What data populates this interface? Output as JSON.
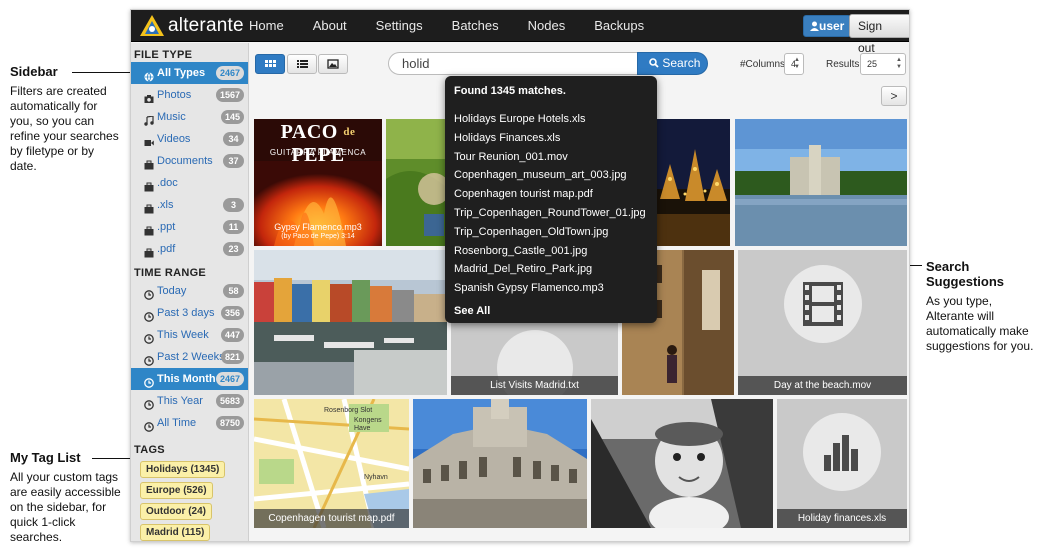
{
  "annotations": {
    "sidebar": {
      "title": "Sidebar",
      "text": "Filters are created automatically for you, so you can refine your searches by filetype or by date."
    },
    "tags": {
      "title": "My Tag List",
      "text": "All your custom tags are easily accessible on the sidebar, for quick 1-click searches."
    },
    "suggestions": {
      "title": "Search Suggestions",
      "text": "As you type, Alterante will automatically make suggestions for you."
    }
  },
  "app": {
    "logo_text": "alterante",
    "nav": [
      "Home",
      "About",
      "Settings",
      "Batches",
      "Nodes",
      "Backups"
    ],
    "user_label": "user",
    "signout_label": "Sign out"
  },
  "sidebar": {
    "file_type_title": "FILE TYPE",
    "file_types": [
      {
        "label": "All Types",
        "count": "2467",
        "icon": "globe-icon",
        "active": true
      },
      {
        "label": "Photos",
        "count": "1567",
        "icon": "camera-icon"
      },
      {
        "label": "Music",
        "count": "145",
        "icon": "music-icon"
      },
      {
        "label": "Videos",
        "count": "34",
        "icon": "video-icon"
      },
      {
        "label": "Documents",
        "count": "37",
        "icon": "briefcase-icon"
      },
      {
        "label": ".doc",
        "count": "",
        "icon": "briefcase-icon"
      },
      {
        "label": ".xls",
        "count": "3",
        "icon": "briefcase-icon"
      },
      {
        "label": ".ppt",
        "count": "11",
        "icon": "briefcase-icon"
      },
      {
        "label": ".pdf",
        "count": "23",
        "icon": "briefcase-icon"
      }
    ],
    "time_range_title": "TIME RANGE",
    "time_ranges": [
      {
        "label": "Today",
        "count": "58"
      },
      {
        "label": "Past 3 days",
        "count": "356"
      },
      {
        "label": "This Week",
        "count": "447"
      },
      {
        "label": "Past 2 Weeks",
        "count": "821"
      },
      {
        "label": "This Month",
        "count": "2467",
        "active": true
      },
      {
        "label": "This Year",
        "count": "5683"
      },
      {
        "label": "All Time",
        "count": "8750"
      }
    ],
    "tags_title": "TAGS",
    "tags": [
      "Holidays (1345)",
      "Europe (526)",
      "Outdoor (24)",
      "Madrid (115)"
    ]
  },
  "toolbar": {
    "search_value": "holid",
    "search_button": "Search",
    "columns_label": "#Columns:",
    "columns_value": "4",
    "results_label": "Results:",
    "results_value": "25",
    "next_label": ">"
  },
  "suggestions": {
    "header": "Found 1345 matches.",
    "items": [
      "Holidays Europe Hotels.xls",
      "Holidays Finances.xls",
      "Tour Reunion_001.mov",
      "Copenhagen_museum_art_003.jpg",
      "Copenhagen tourist map.pdf",
      "Trip_Copenhagen_RoundTower_01.jpg",
      "Trip_Copenhagen_OldTown.jpg",
      "Rosenborg_Castle_001.jpg",
      "Madrid_Del_Retiro_Park.jpg",
      "Spanish Gypsy Flamenco.mp3"
    ],
    "see_all": "See All"
  },
  "tiles": {
    "album_title_1": "PACO",
    "album_amp": "de",
    "album_title_2": "PEPE",
    "album_sub": "GUITARRA FLAMENCA",
    "album_caption_1": "Gypsy Flamenco.mp3",
    "album_caption_2": "(by Paco de Pepe) 3:14",
    "list_caption": "List Visits Madrid.txt",
    "beach_caption": "Day at the beach.mov",
    "map_caption": "Copenhagen tourist map.pdf",
    "finances_caption": "Holiday finances.xls",
    "map_labels": [
      "Rosenborg Slot",
      "Kongens",
      "Have",
      "Nyhavn"
    ]
  }
}
